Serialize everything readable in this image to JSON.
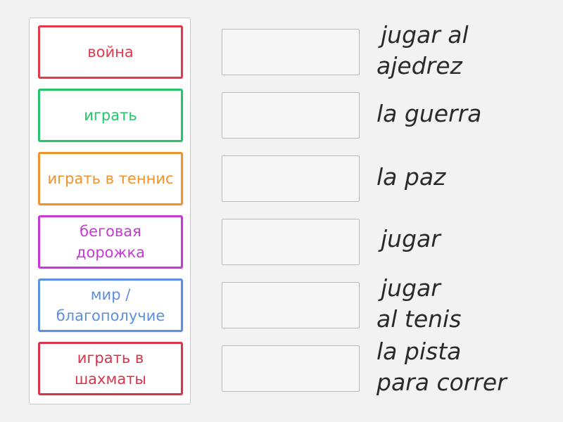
{
  "cards": [
    {
      "label": "война",
      "color": "#e23a4d"
    },
    {
      "label": "играть",
      "color": "#26c46b"
    },
    {
      "label": "играть в теннис",
      "color": "#f0922e"
    },
    {
      "label": "беговая дорожка",
      "color": "#c53ad6"
    },
    {
      "label": "мир / благополучие",
      "color": "#5b8fe0"
    },
    {
      "label": "играть в шахматы",
      "color": "#d8344a"
    }
  ],
  "answers": [
    {
      "line1": "jugar al",
      "line2": "ajedrez"
    },
    {
      "line1": "la guerra",
      "line2": ""
    },
    {
      "line1": "la paz",
      "line2": ""
    },
    {
      "line1": "jugar",
      "line2": ""
    },
    {
      "line1": "jugar",
      "line2": "al tenis"
    },
    {
      "line1": "la pista",
      "line2": "para correr"
    }
  ]
}
